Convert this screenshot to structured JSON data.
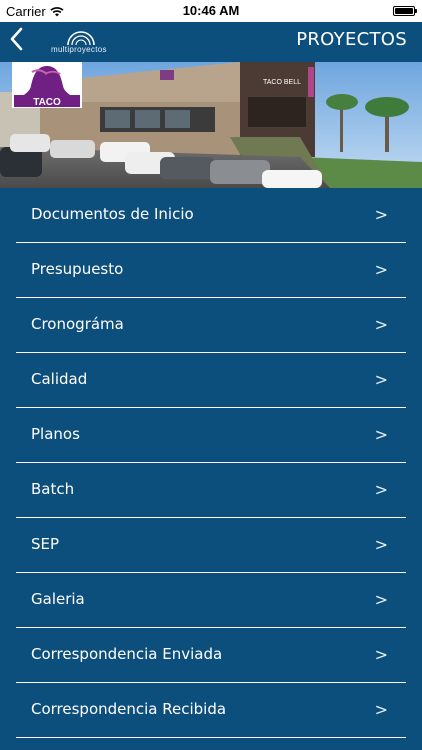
{
  "status_bar": {
    "carrier": "Carrier",
    "time": "10:46 AM"
  },
  "nav": {
    "brand_name": "multiproyectos",
    "title": "PROYECTOS"
  },
  "hero": {
    "logo_text": "TACO",
    "sign_text": "TACO BELL"
  },
  "menu": {
    "chevron": ">",
    "items": [
      {
        "label": "Documentos de Inicio"
      },
      {
        "label": "Presupuesto"
      },
      {
        "label": "Cronográma"
      },
      {
        "label": "Calidad"
      },
      {
        "label": "Planos"
      },
      {
        "label": "Batch"
      },
      {
        "label": "SEP"
      },
      {
        "label": "Galeria"
      },
      {
        "label": "Correspondencia Enviada"
      },
      {
        "label": "Correspondencia Recibida"
      }
    ]
  }
}
